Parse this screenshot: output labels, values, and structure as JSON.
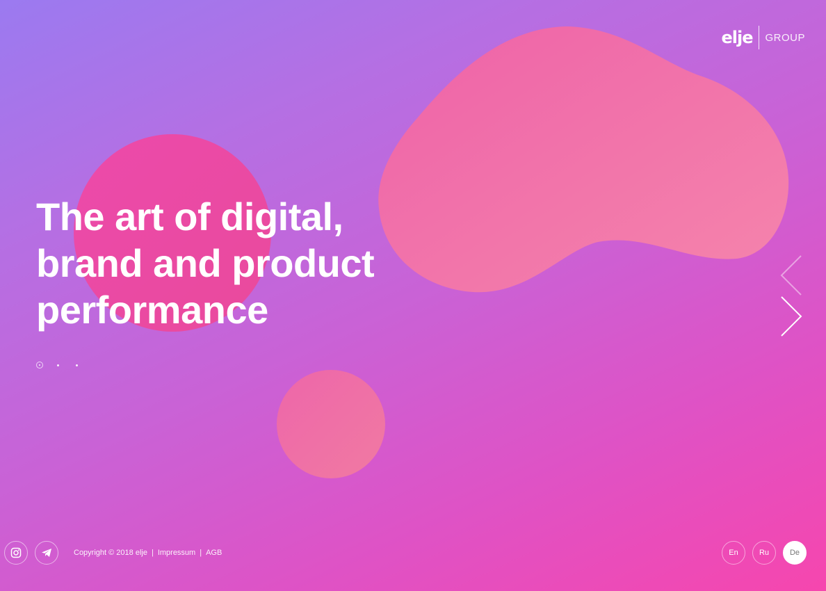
{
  "logo": {
    "word": "elje",
    "suffix": "GROUP"
  },
  "hero": {
    "headline_lines": [
      "The art of digital,",
      "brand and product",
      "performance"
    ]
  },
  "slider": {
    "dot_count": 3,
    "active_dot": 0
  },
  "social": {
    "items": [
      {
        "icon": "instagram-icon"
      },
      {
        "icon": "telegram-icon"
      }
    ]
  },
  "footer": {
    "copyright": "Copyright © 2018 elje",
    "separator": "|",
    "impressum": "Impressum",
    "agb": "AGB"
  },
  "languages": {
    "items": [
      {
        "label": "En",
        "active": false
      },
      {
        "label": "Ru",
        "active": false
      },
      {
        "label": "De",
        "active": true
      }
    ]
  },
  "colors": {
    "gradient_start": "#9b7af0",
    "gradient_end": "#f646ae",
    "blob_pink": "#f179a8",
    "circle_pink": "#ec4fac"
  }
}
